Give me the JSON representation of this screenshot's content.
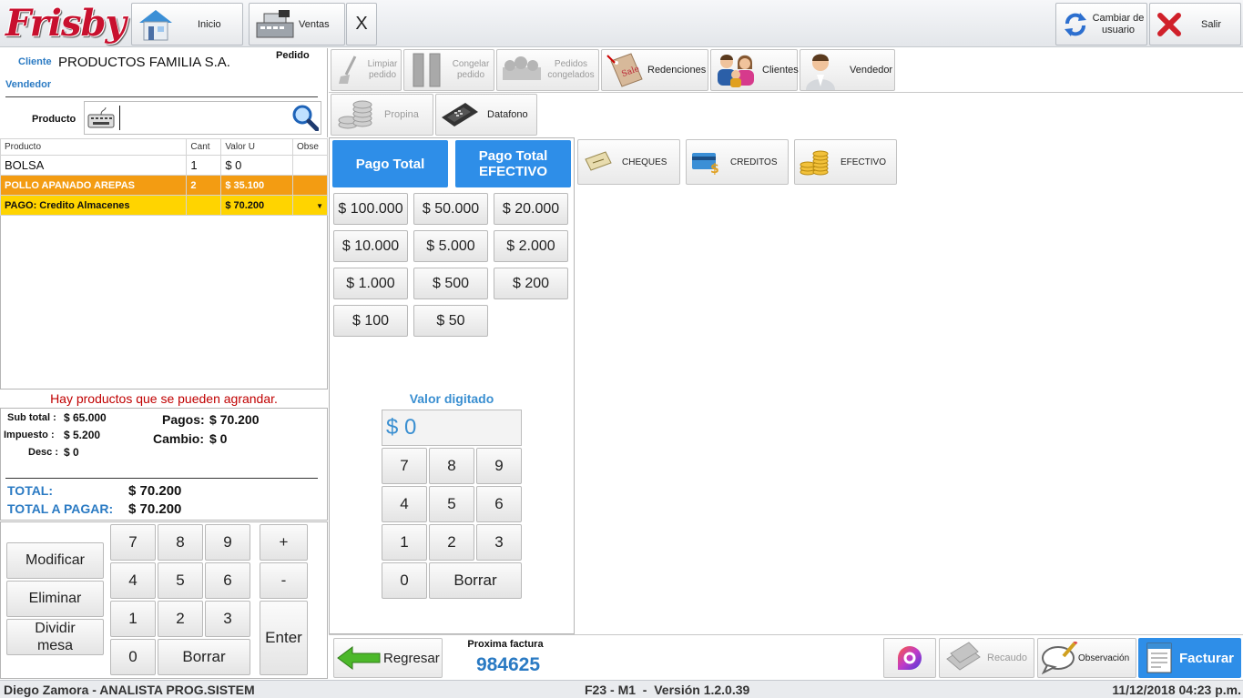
{
  "brand": {
    "name": "Frisby",
    "color": "#c8102e"
  },
  "topbar": {
    "inicio": "Inicio",
    "ventas": "Ventas",
    "close": "X",
    "cambiar_usuario": "Cambiar de usuario",
    "salir": "Salir"
  },
  "order": {
    "cliente_label": "Cliente",
    "cliente_value": "PRODUCTOS FAMILIA S.A.",
    "pedido_label": "Pedido",
    "vendedor_label": "Vendedor",
    "producto_label": "Producto",
    "producto_value": ""
  },
  "table": {
    "headers": [
      "Producto",
      "Cant",
      "Valor U",
      "Obse"
    ],
    "rows": [
      {
        "producto": "BOLSA",
        "cant": "1",
        "valor": "$ 0"
      },
      {
        "producto": "POLLO APANADO AREPAS",
        "cant": "2",
        "valor": "$ 35.100"
      },
      {
        "producto": "PAGO: Credito Almacenes",
        "cant": "",
        "valor": "$ 70.200"
      }
    ]
  },
  "warning": "Hay productos que se pueden agrandar.",
  "totals": {
    "subtotal_label": "Sub total :",
    "subtotal_value": "$ 65.000",
    "impuesto_label": "Impuesto :",
    "impuesto_value": "$ 5.200",
    "desc_label": "Desc :",
    "desc_value": "$ 0",
    "pagos_label": "Pagos:",
    "pagos_value": "$ 70.200",
    "cambio_label": "Cambio:",
    "cambio_value": "$ 0",
    "total_label": "TOTAL:",
    "total_value": "$ 70.200",
    "total_pagar_label": "TOTAL A PAGAR:",
    "total_pagar_value": "$ 70.200"
  },
  "left_actions": {
    "modificar": "Modificar",
    "eliminar": "Eliminar",
    "dividir": "Dividir mesa"
  },
  "keypad_left": {
    "keys": [
      "7",
      "8",
      "9",
      "4",
      "5",
      "6",
      "1",
      "2",
      "3",
      "0"
    ],
    "borrar": "Borrar",
    "plus": "+",
    "minus": "-",
    "enter": "Enter"
  },
  "toolbar": {
    "limpiar": "Limpiar pedido",
    "congelar": "Congelar pedido",
    "pedidos_congelados": "Pedidos congelados",
    "redenciones": "Redenciones",
    "clientes": "Clientes",
    "vendedor": "Vendedor",
    "propina": "Propina",
    "datafono": "Datafono"
  },
  "payment": {
    "pago_total": "Pago Total",
    "pago_total_efectivo": "Pago Total EFECTIVO",
    "amounts": [
      "$ 100.000",
      "$ 50.000",
      "$ 20.000",
      "$ 10.000",
      "$ 5.000",
      "$ 2.000",
      "$ 1.000",
      "$ 500",
      "$ 200",
      "$ 100",
      "$ 50"
    ],
    "valor_digitado_label": "Valor digitado",
    "valor_digitado_value": "$ 0",
    "keys": [
      "7",
      "8",
      "9",
      "4",
      "5",
      "6",
      "1",
      "2",
      "3",
      "0"
    ],
    "borrar": "Borrar"
  },
  "methods": {
    "cheques": "CHEQUES",
    "creditos": "CREDITOS",
    "efectivo": "EFECTIVO"
  },
  "bottom": {
    "regresar": "Regresar",
    "proxima_label": "Proxima factura",
    "proxima_value": "984625",
    "recaudo": "Recaudo",
    "observacion": "Observación",
    "facturar": "Facturar"
  },
  "status": {
    "user": "Diego Zamora - ANALISTA PROG.SISTEM",
    "version": "F23 - M1  -  Versión 1.2.0.39",
    "datetime": "11/12/2018 04:23 p.m."
  },
  "colors": {
    "accent_blue": "#2e8ee8",
    "row_orange": "#f39c12",
    "row_yellow": "#ffd400",
    "label_blue": "#2a7ac3"
  }
}
